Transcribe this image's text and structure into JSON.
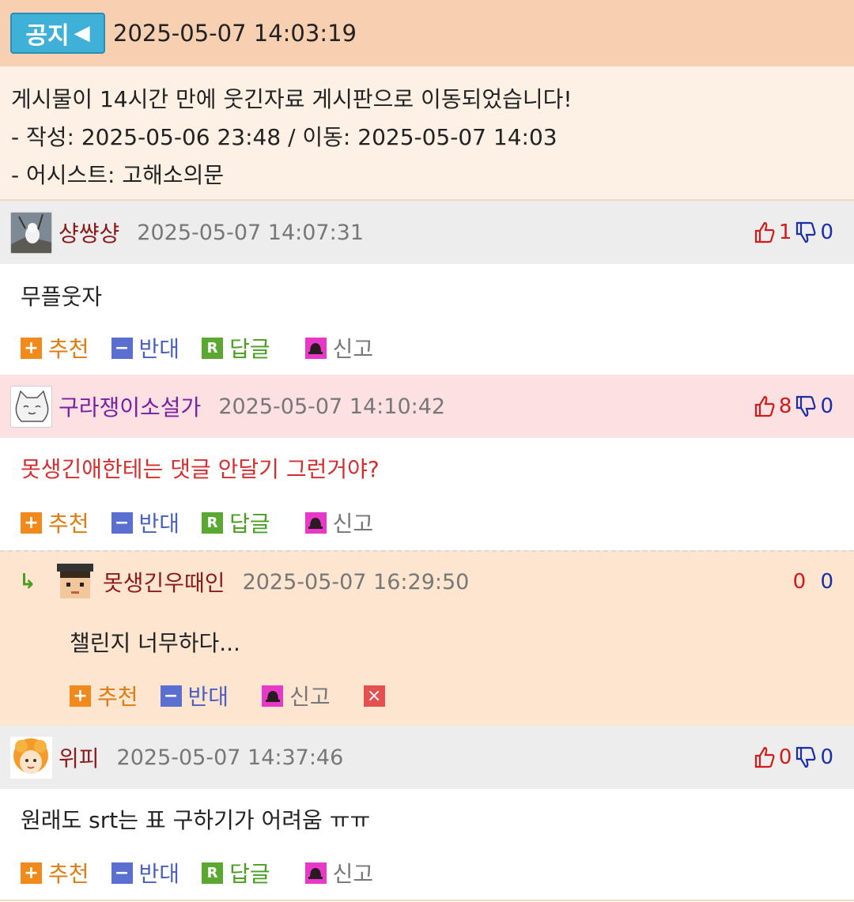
{
  "notice": {
    "badge": "공지",
    "timestamp": "2025-05-07 14:03:19",
    "lines": [
      "게시물이 14시간 만에 웃긴자료 게시판으로 이동되었습니다!",
      "- 작성: 2025-05-06 23:48 / 이동: 2025-05-07 14:03",
      "- 어시스트: 고해소의문"
    ]
  },
  "actions": {
    "recommend": "추천",
    "oppose": "반대",
    "reply": "답글",
    "report": "신고",
    "delete_icon": "×"
  },
  "comments": [
    {
      "nick": "샹썅샹",
      "time": "2025-05-07 14:07:31",
      "up": "1",
      "down": "0",
      "text": "무플웃자"
    },
    {
      "nick": "구라쟁이소설가",
      "time": "2025-05-07 14:10:42",
      "up": "8",
      "down": "0",
      "text": "못생긴애한테는 댓글 안달기 그런거야?"
    },
    {
      "nick": "위피",
      "time": "2025-05-07 14:37:46",
      "up": "0",
      "down": "0",
      "text": "원래도 srt는 표 구하기가 어려움 ㅠㅠ"
    }
  ],
  "reply": {
    "arrow": "↳",
    "nick": "못생긴우때인",
    "time": "2025-05-07 16:29:50",
    "up": "0",
    "down": "0",
    "text": "챌린지 너무하다..."
  },
  "colors": {
    "notice_bg": "#f7cfb1",
    "reply_bg": "#fde5cf",
    "vote_up": "#d21a1a",
    "vote_down": "#1a2ea8"
  }
}
